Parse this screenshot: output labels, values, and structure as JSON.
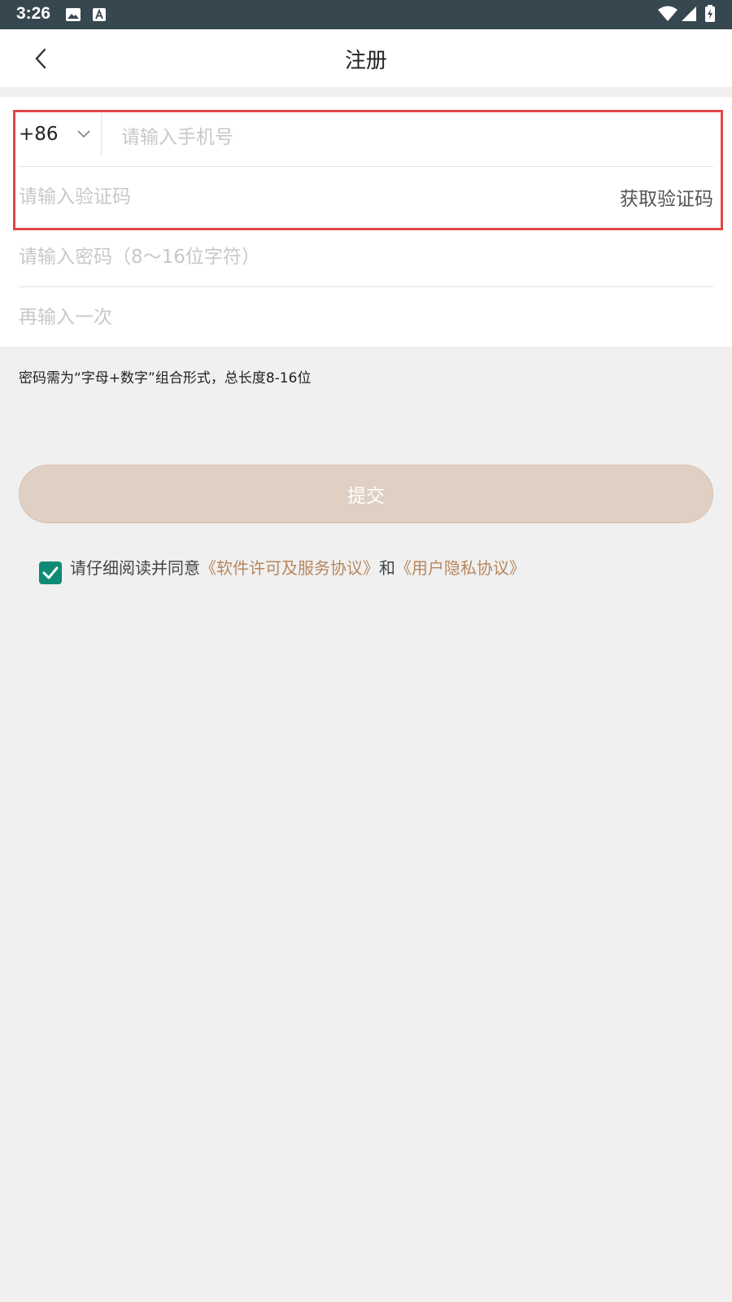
{
  "status_bar": {
    "time": "3:26"
  },
  "nav": {
    "title": "注册"
  },
  "form": {
    "country_code": "+86",
    "phone_placeholder": "请输入手机号",
    "code_placeholder": "请输入验证码",
    "get_code_label": "获取验证码",
    "password_placeholder": "请输入密码（8～16位字符）",
    "confirm_placeholder": "再输入一次"
  },
  "hint": "密码需为“字母+数字”组合形式，总长度8-16位",
  "submit_label": "提交",
  "agreement": {
    "prefix": "请仔细阅读并同意",
    "link1": "《软件许可及服务协议》",
    "joiner": "和",
    "link2": "《用户隐私协议》",
    "checked": true
  },
  "colors": {
    "status_bar": "#37474f",
    "accent_link": "#b8875f",
    "checkbox": "#0f8a76",
    "submit_bg": "#e0cfc3",
    "highlight": "#e04848"
  }
}
